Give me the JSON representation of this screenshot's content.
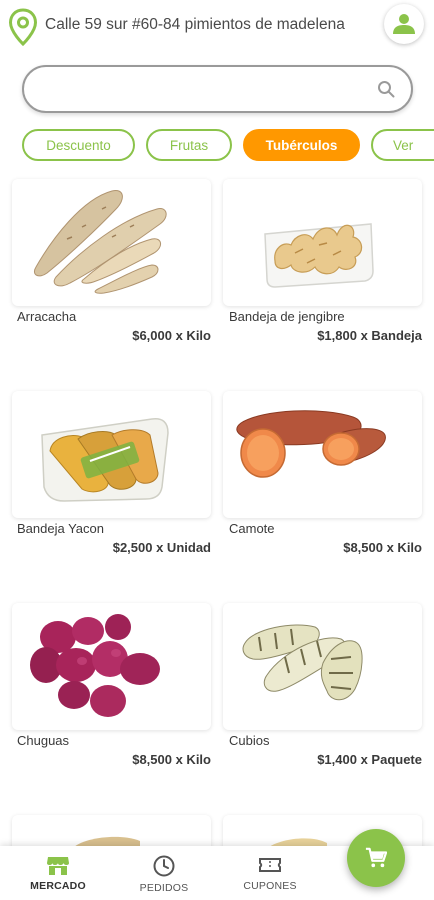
{
  "header": {
    "address": "Calle 59 sur #60-84 pimientos de madelena",
    "icons": {
      "location": "map-pin-icon",
      "user": "user-icon"
    },
    "accent": "#8bc34a"
  },
  "search": {
    "value": "",
    "placeholder": "",
    "icon": "search-icon"
  },
  "categories": [
    {
      "label": "Descuento",
      "active": false
    },
    {
      "label": "Frutas",
      "active": false
    },
    {
      "label": "Tubérculos",
      "active": true
    },
    {
      "label": "Ver",
      "active": false
    }
  ],
  "colors": {
    "active_chip": "#ff9800",
    "chip_border": "#8bc34a"
  },
  "products": [
    {
      "name": "Arracacha",
      "price": "$6,000 x Kilo",
      "image": "arracacha"
    },
    {
      "name": "Bandeja de jengibre",
      "price": "$1,800 x Bandeja",
      "image": "ginger-tray"
    },
    {
      "name": "Bandeja Yacon",
      "price": "$2,500 x Unidad",
      "image": "yacon-tray"
    },
    {
      "name": "Camote",
      "price": "$8,500 x Kilo",
      "image": "sweet-potato"
    },
    {
      "name": "Chuguas",
      "price": "$8,500 x Kilo",
      "image": "purple-potatoes"
    },
    {
      "name": "Cubios",
      "price": "$1,400 x Paquete",
      "image": "cubios"
    }
  ],
  "bottom_nav": [
    {
      "label": "MERCADO",
      "icon": "store-icon",
      "active": true
    },
    {
      "label": "PEDIDOS",
      "icon": "clock-icon",
      "active": false
    },
    {
      "label": "CUPONES",
      "icon": "ticket-icon",
      "active": false
    }
  ],
  "cart": {
    "icon": "cart-icon"
  }
}
